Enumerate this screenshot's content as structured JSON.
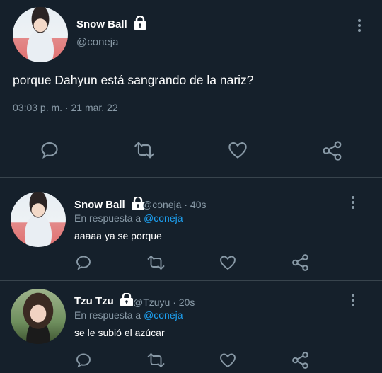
{
  "main_tweet": {
    "display_name": "Snow Ball",
    "handle": "@coneja",
    "text": "porque Dahyun está sangrando de la nariz?",
    "timestamp": "03:03 p. m. · 21 mar. 22",
    "actions": [
      "reply-icon",
      "retweet-icon",
      "like-icon",
      "share-icon"
    ]
  },
  "replies": [
    {
      "display_name": "Snow Ball",
      "handle_time": "@coneja · 40s",
      "reply_to_prefix": "En respuesta a",
      "reply_to_handle": "@coneja",
      "text": "aaaaa ya se porque"
    },
    {
      "display_name": "Tzu Tzu",
      "handle_time": "@Tzuyu · 20s",
      "reply_to_prefix": "En respuesta a",
      "reply_to_handle": "@coneja",
      "text": "se le subió el azúcar"
    }
  ],
  "colors": {
    "background": "#15202b",
    "muted": "#8899a6",
    "link": "#1da1f2",
    "divider": "#38444d"
  }
}
